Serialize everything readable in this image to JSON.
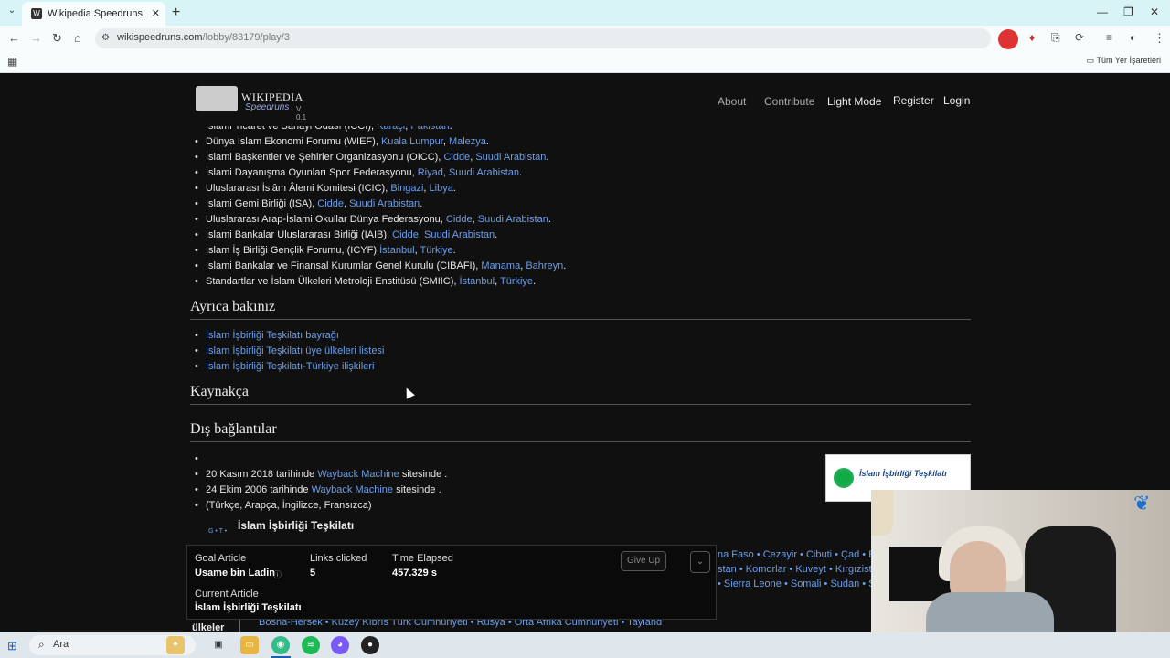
{
  "browser": {
    "tab_title": "Wikipedia Speedruns!",
    "url_host": "wikispeedruns.com",
    "url_path": "/lobby/83179/play/3",
    "bookmarks_all": "Tüm Yer İşaretleri"
  },
  "site": {
    "logo_line1": "WIKIPEDIA",
    "logo_line2": "Speedruns",
    "logo_version": "V. 0.1",
    "menu": {
      "about": "About",
      "contribute": "Contribute",
      "light_mode": "Light Mode",
      "register": "Register",
      "login": "Login"
    }
  },
  "article": {
    "partial_top": {
      "text": "İslami Ticaret ve Sanayi Odası (ICCI), ",
      "l1": "Karaçi",
      "l2": "Pakistan"
    },
    "orgs": [
      {
        "text": "Dünya İslam Ekonomi Forumu (WIEF), ",
        "l1": "Kuala Lumpur",
        "l2": "Malezya"
      },
      {
        "text": "İslami Başkentler ve Şehirler Organizasyonu (OICC), ",
        "l1": "Cidde",
        "l2": "Suudi Arabistan"
      },
      {
        "text": "İslami Dayanışma Oyunları Spor Federasyonu, ",
        "l1": "Riyad",
        "l2": "Suudi Arabistan"
      },
      {
        "text": "Uluslararası İslâm Âlemi Komitesi (ICIC), ",
        "l1": "Bingazi",
        "l2": "Libya"
      },
      {
        "text": "İslami Gemi Birliği (ISA), ",
        "l1": "Cidde",
        "l2": "Suudi Arabistan"
      },
      {
        "text": "Uluslararası Arap-İslami Okullar Dünya Federasyonu, ",
        "l1": "Cidde",
        "l2": "Suudi Arabistan"
      },
      {
        "text": "İslami Bankalar Uluslararası Birliği (IAIB), ",
        "l1": "Cidde",
        "l2": "Suudi Arabistan"
      },
      {
        "text": "İslam İş Birliği Gençlik Forumu, (ICYF) ",
        "l1": "İstanbul",
        "l2": "Türkiye"
      },
      {
        "text": "İslami Bankalar ve Finansal Kurumlar Genel Kurulu (CIBAFI), ",
        "l1": "Manama",
        "l2": "Bahreyn"
      },
      {
        "text": "Standartlar ve İslam Ülkeleri Metroloji Enstitüsü (SMIIC), ",
        "l1": "İstanbul",
        "l2": "Türkiye"
      }
    ],
    "see_also_heading": "Ayrıca bakınız",
    "see_also": [
      "İslam İşbirliği Teşkilatı bayrağı",
      "İslam İşbirliği Teşkilatı üye ülkeleri listesi",
      "İslam İşbirliği Teşkilatı-Türkiye ilişkileri"
    ],
    "references_heading": "Kaynakça",
    "external_heading": "Dış bağlantılar",
    "external": [
      {
        "pre": "20 Kasım 2018 tarihinde ",
        "link": "Wayback Machine",
        "post": " sitesinde ."
      },
      {
        "pre": "24 Ekim 2006 tarihinde ",
        "link": "Wayback Machine",
        "post": " sitesinde ."
      },
      {
        "pre": "(Türkçe, Arapça, İngilizce, Fransızca)",
        "link": "",
        "post": ""
      }
    ],
    "commons_box_title": "İslam İşbirliği Teşkilatı",
    "navbox_title": "İslam İşbirliği Teşkilatı",
    "navbox_gt": "G • T •",
    "navbox_row1": "na Faso • Cezayir • Cibuti • Çad • Endo",
    "navbox_row2": "stan • Komorlar • Kuveyt • Kırgızistan",
    "navbox_row3": "• Sierra Leone • Somali • Sudan • Surin",
    "navbox_row4": "Bosna-Hersek • Kuzey Kıbrıs Türk Cumhuriyeti • Rusya • Orta Afrika Cumhuriyeti • Tayland",
    "navbox_side_label": "ülkeler"
  },
  "hud": {
    "goal_label": "Goal Article",
    "goal_value": "Usame bin Ladin",
    "links_label": "Links clicked",
    "links_value": "5",
    "time_label": "Time Elapsed",
    "time_value": "457.329 s",
    "current_label": "Current Article",
    "current_value": "İslam İşbirliği Teşkilatı",
    "give_up": "Give Up"
  },
  "taskbar": {
    "search": "Ara"
  }
}
